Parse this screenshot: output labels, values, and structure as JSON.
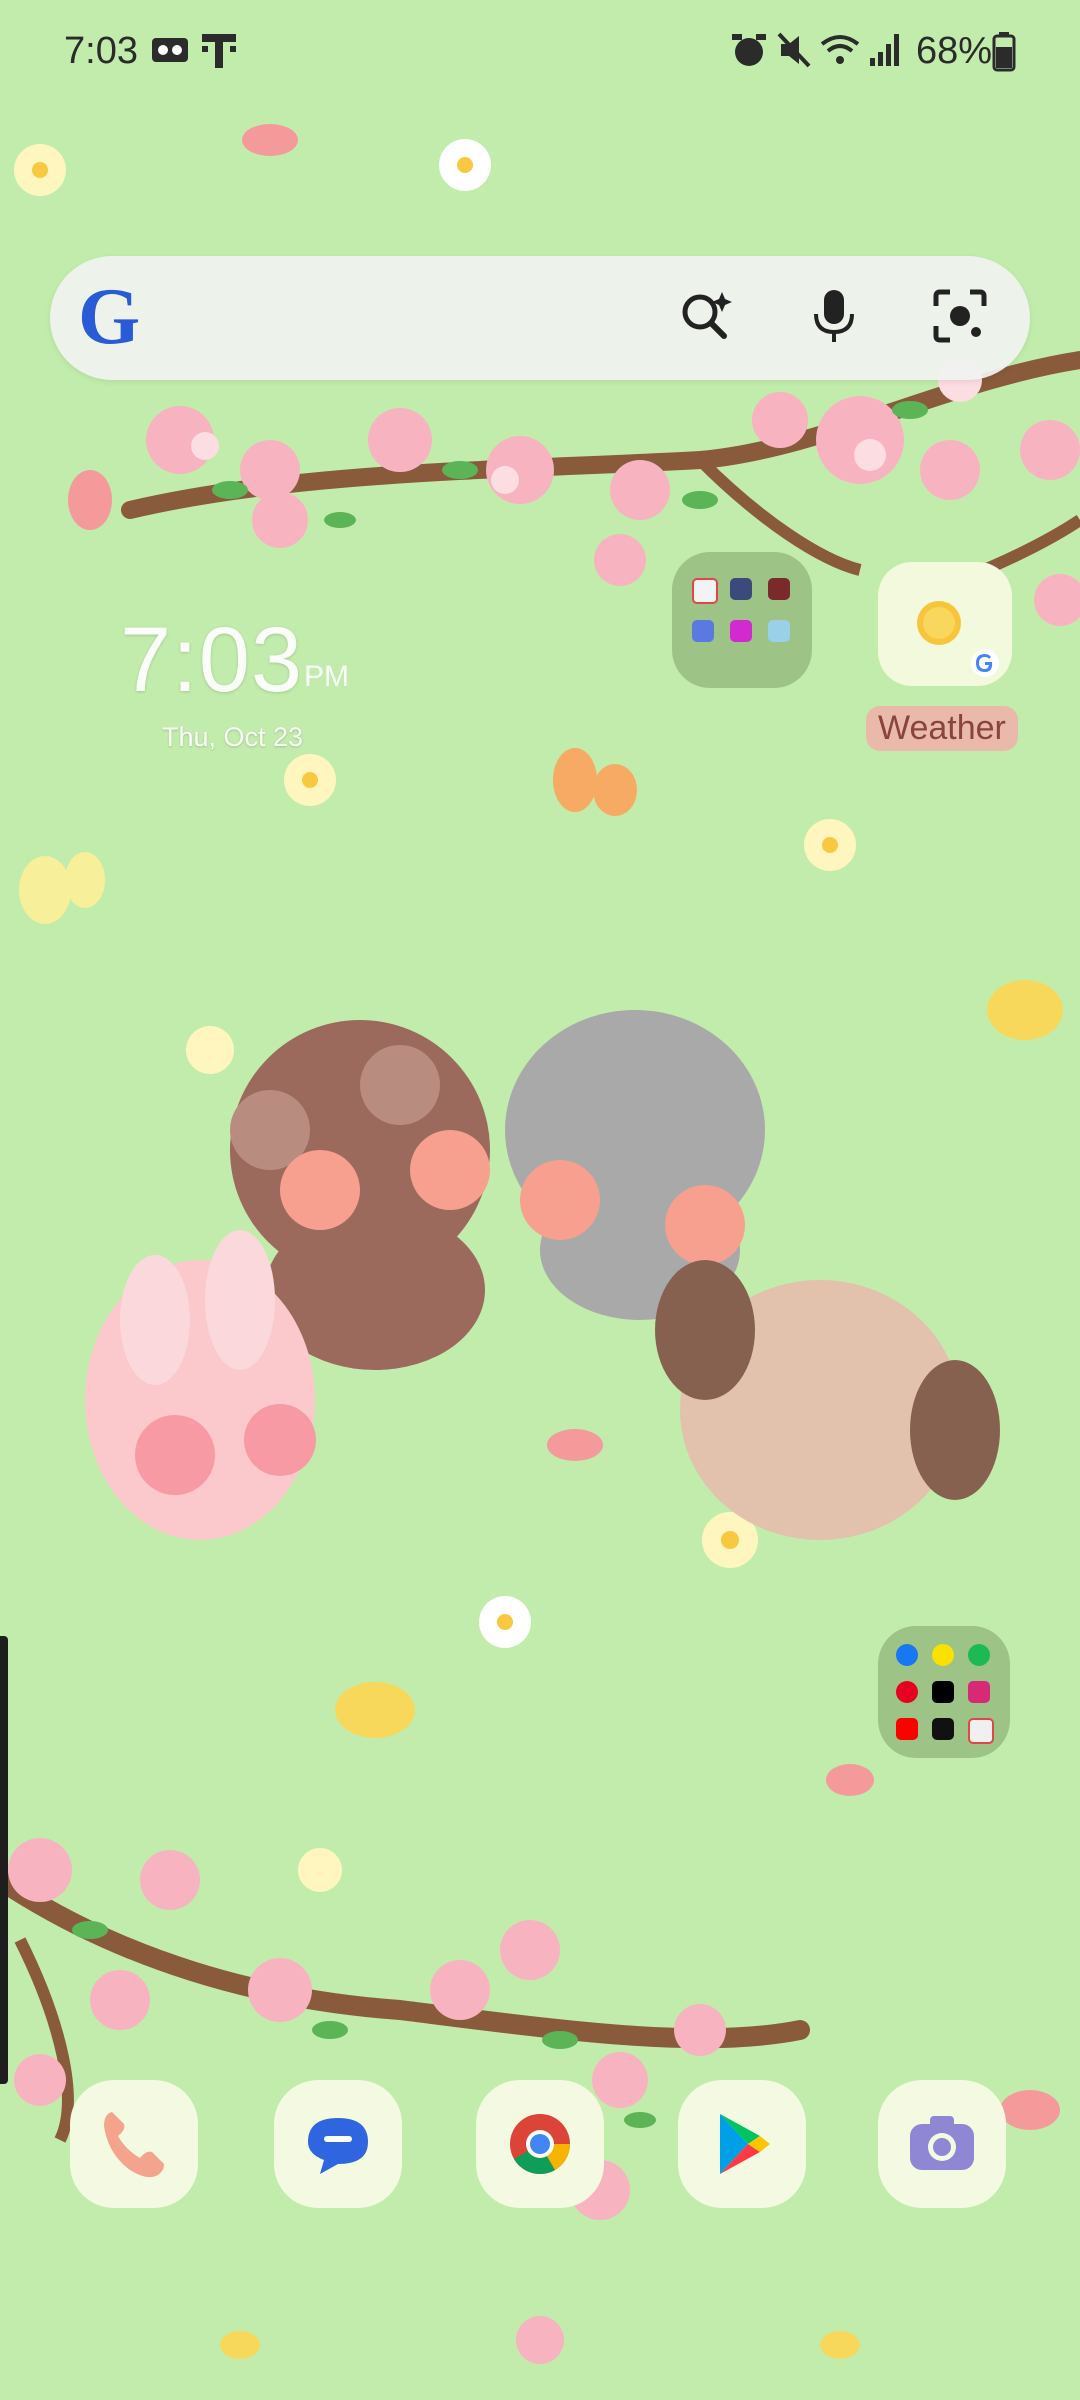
{
  "status_bar": {
    "time": "7:03",
    "battery_percent": "68%",
    "icons": [
      "voicemail-icon",
      "t-mobile-icon",
      "alarm-icon",
      "mute-icon",
      "wifi-icon",
      "signal-icon",
      "battery-icon"
    ]
  },
  "search_bar": {
    "logo_letter": "G",
    "icons": [
      "ai-search-icon",
      "microphone-icon",
      "camera-lens-icon"
    ]
  },
  "clock_widget": {
    "time": "7:03",
    "ampm": "PM",
    "date": "Thu, Oct 23"
  },
  "weather_widget": {
    "label": "Weather",
    "icons": [
      "sun-icon",
      "google-icon"
    ]
  },
  "folders": {
    "top_folder": {
      "apps": [
        "pokemon-icon",
        "app-icon",
        "app-icon",
        "app-icon",
        "app-icon",
        "app-icon"
      ]
    },
    "social_folder": {
      "apps": [
        "facebook-icon",
        "kakaotalk-icon",
        "spotify-icon",
        "pinterest-icon",
        "x-icon",
        "instagram-icon",
        "youtube-icon",
        "tiktok-icon",
        "app-icon"
      ]
    }
  },
  "dock": {
    "apps": [
      "phone-icon",
      "messages-icon",
      "chrome-icon",
      "play-store-icon",
      "camera-icon"
    ]
  },
  "colors": {
    "background": "#c2ecac",
    "folder": "#9dc486",
    "search": "#f0f3f0",
    "accent_pink": "#f7b3c0"
  }
}
